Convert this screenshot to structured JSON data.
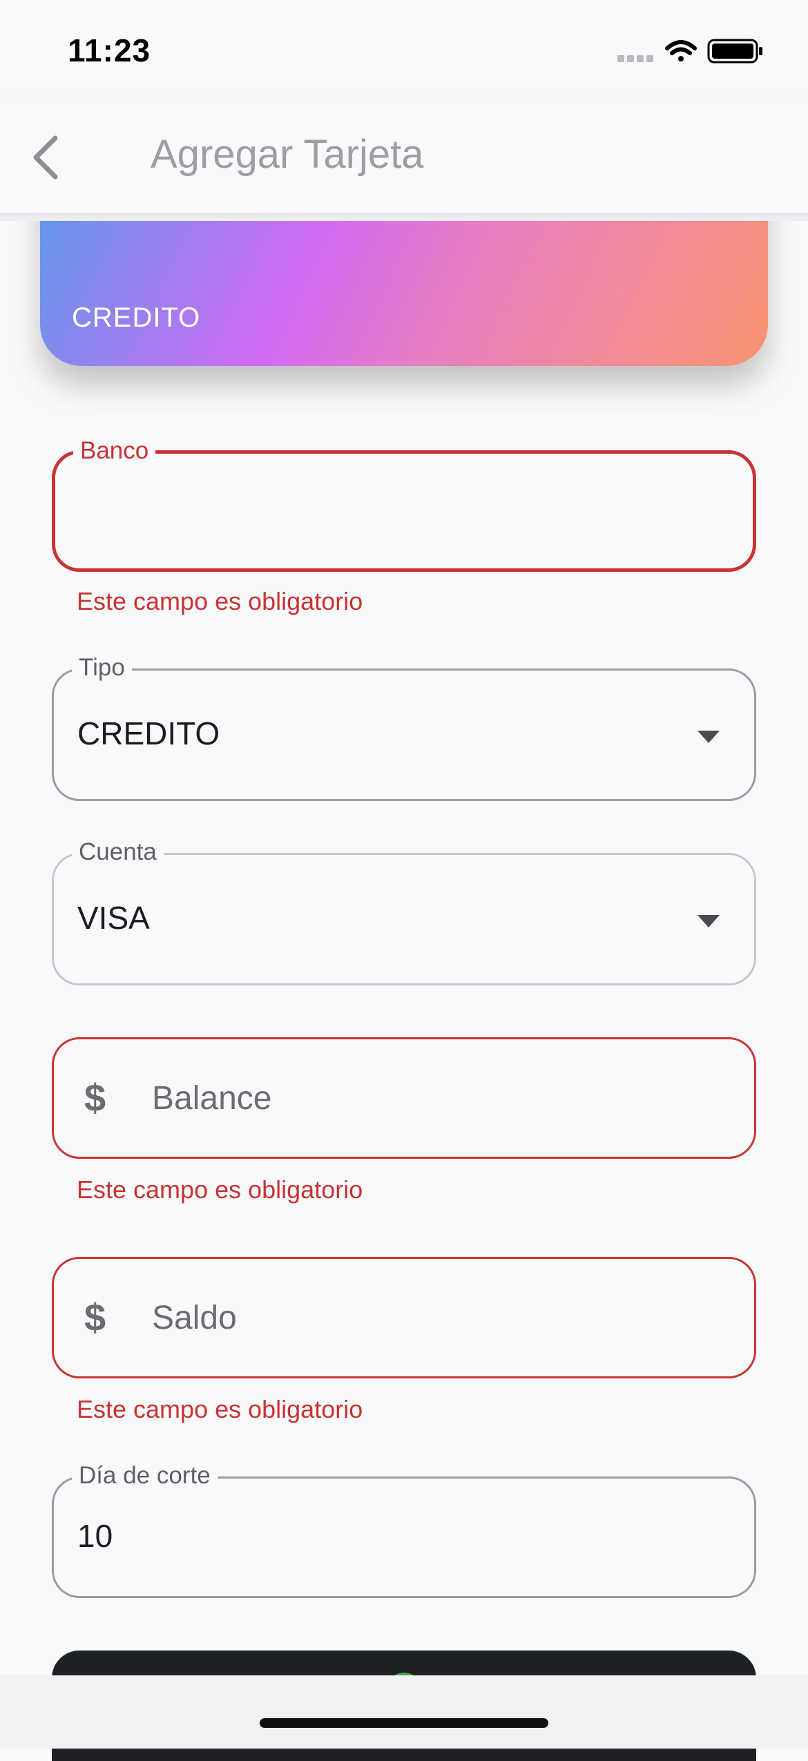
{
  "status_bar": {
    "time": "11:23"
  },
  "app_bar": {
    "title": "Agregar Tarjeta"
  },
  "card": {
    "type_label": "CREDITO",
    "gradient_colors": [
      "#5b9be9",
      "#d26af2",
      "#fb9471"
    ]
  },
  "form": {
    "banco": {
      "label": "Banco",
      "value": "",
      "error": "Este campo es obligatorio"
    },
    "tipo": {
      "label": "Tipo",
      "selected": "CREDITO"
    },
    "cuenta": {
      "label": "Cuenta",
      "selected": "VISA"
    },
    "balance": {
      "placeholder": "Balance",
      "prefix": "$",
      "error": "Este campo es obligatorio"
    },
    "saldo": {
      "placeholder": "Saldo",
      "prefix": "$",
      "error": "Este campo es obligatorio"
    },
    "dia_corte": {
      "label": "Día de corte",
      "value": "10"
    }
  },
  "colors": {
    "error": "#c93332",
    "background": "#f8f9fb",
    "button": "#1d2125"
  }
}
